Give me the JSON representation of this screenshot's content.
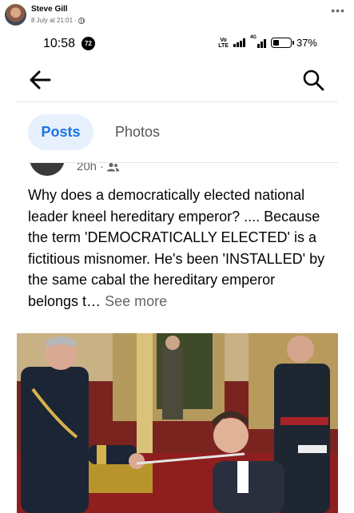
{
  "fb_post": {
    "author": "Steve Gill",
    "date": "8 July at 21:01",
    "separator": "·",
    "more_icon": "more-dots-icon"
  },
  "status_bar": {
    "time": "10:58",
    "notification_count": "72",
    "volte_top": "Vo",
    "volte_bottom": "LTE",
    "network": "4G",
    "battery_percent": "37%",
    "battery_level": 0.37
  },
  "nav": {
    "back_icon": "back-arrow-icon",
    "search_icon": "search-icon"
  },
  "tabs": [
    {
      "label": "Posts",
      "active": true
    },
    {
      "label": "Photos",
      "active": false
    }
  ],
  "post": {
    "time": "20h",
    "dot": "·",
    "audience_icon": "friends-icon",
    "text": "Why does a democratically elected national leader kneel hereditary emperor? .... Because the term 'DEMOCRATICALLY ELECTED' is a fictitious misnomer. He's been 'INSTALLED' by the same cabal the hereditary emperor belongs t…",
    "see_more": "See more"
  },
  "colors": {
    "accent": "#1b74e4",
    "active_tab_bg": "#e7f0fd",
    "muted_text": "#65676b"
  }
}
